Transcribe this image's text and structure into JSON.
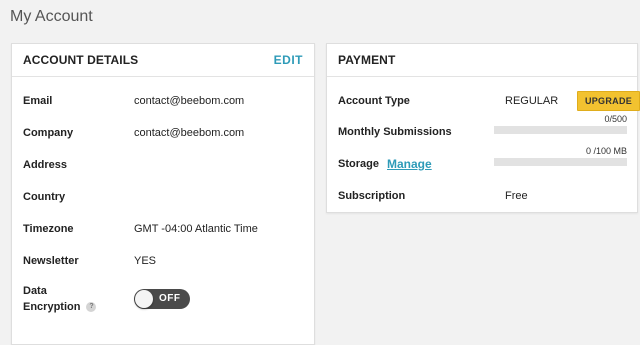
{
  "page": {
    "title": "My Account"
  },
  "account": {
    "header": "ACCOUNT DETAILS",
    "edit_label": "EDIT",
    "fields": [
      {
        "label": "Email",
        "value": "contact@beebom.com"
      },
      {
        "label": "Company",
        "value": "contact@beebom.com"
      },
      {
        "label": "Address",
        "value": ""
      },
      {
        "label": "Country",
        "value": ""
      },
      {
        "label": "Timezone",
        "value": "GMT -04:00 Atlantic Time"
      },
      {
        "label": "Newsletter",
        "value": "YES"
      }
    ],
    "encryption": {
      "label_line1": "Data",
      "label_line2": "Encryption",
      "help": "?",
      "state": "OFF"
    }
  },
  "payment": {
    "header": "PAYMENT",
    "account_type": {
      "label": "Account Type",
      "value": "REGULAR",
      "upgrade_label": "UPGRADE"
    },
    "monthly_submissions": {
      "label": "Monthly Submissions",
      "usage": "0/500",
      "fraction": 0
    },
    "storage": {
      "label": "Storage",
      "manage_label": "Manage",
      "usage": "0 /100 MB",
      "fraction": 0
    },
    "subscription": {
      "label": "Subscription",
      "value": "Free"
    }
  },
  "colors": {
    "accent": "#2e9bb8",
    "upgrade": "#f2c230",
    "toggle_off": "#4a4a4a"
  }
}
